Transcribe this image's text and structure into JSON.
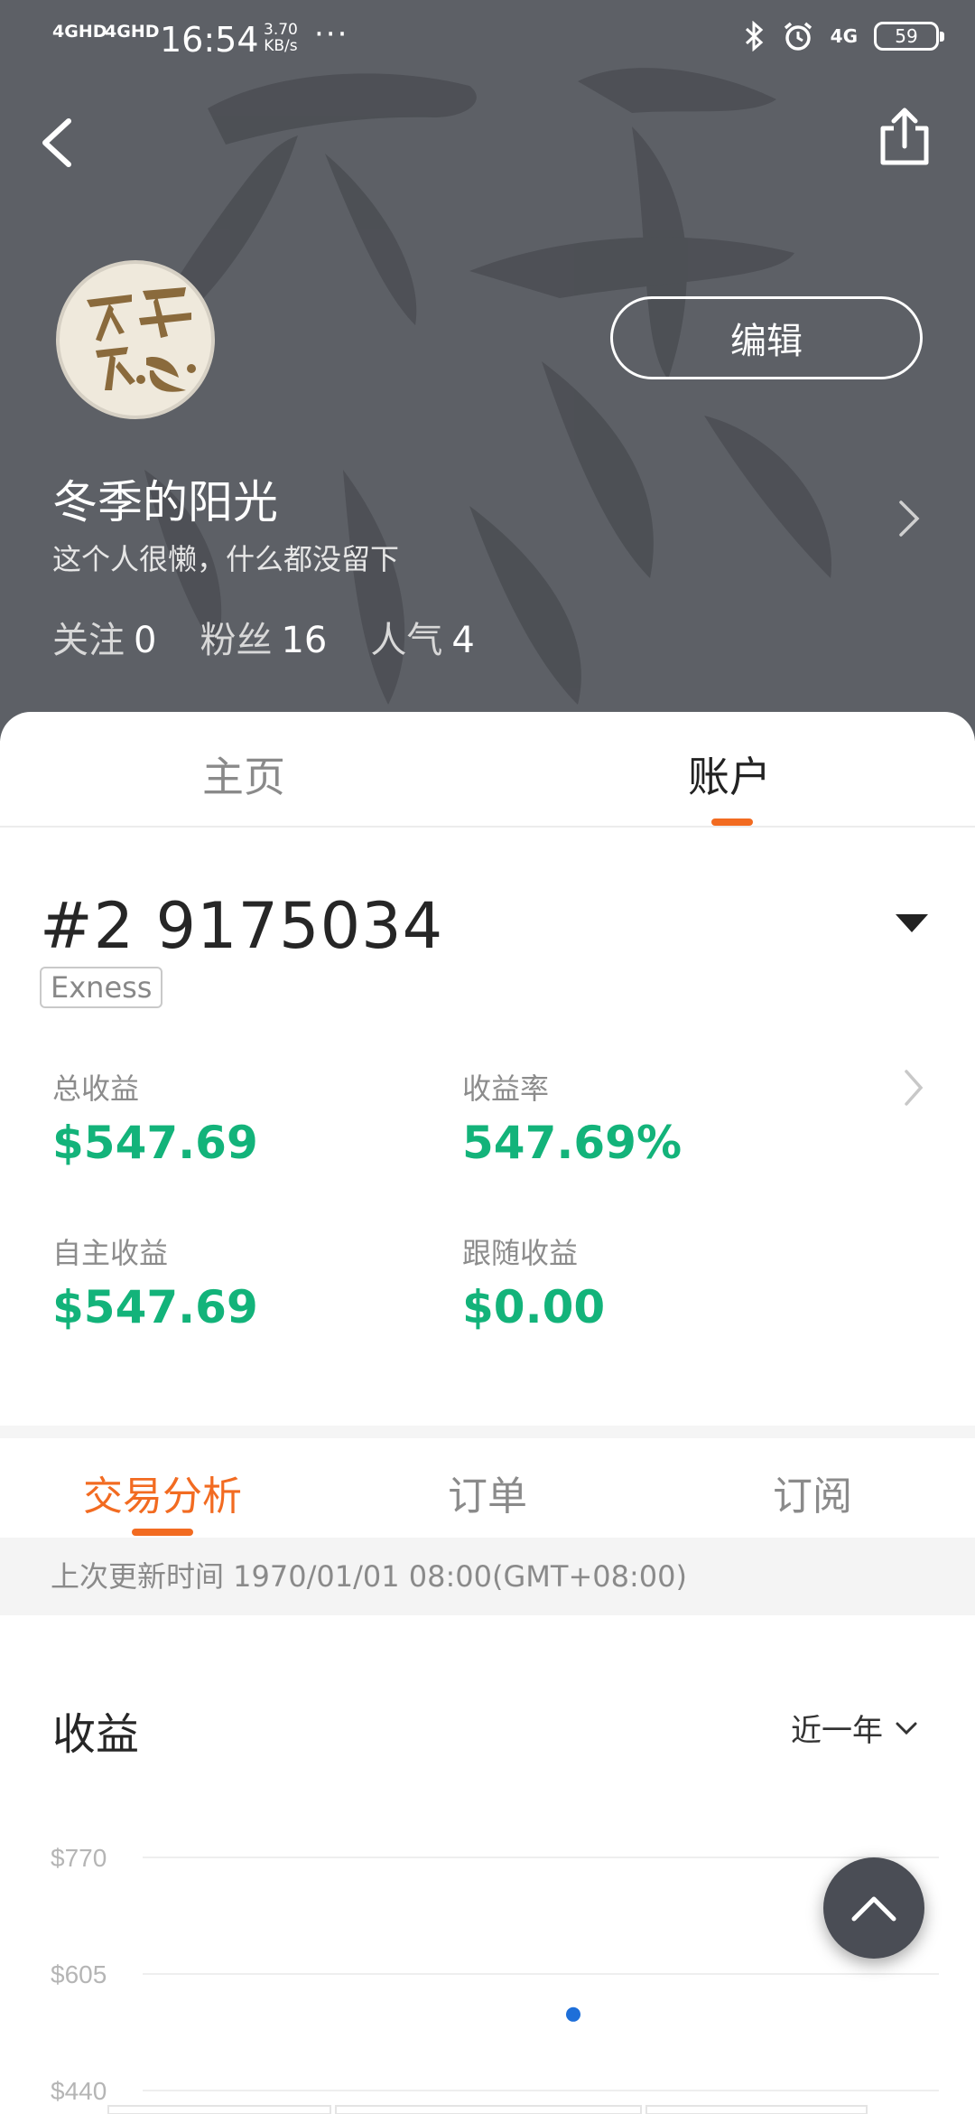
{
  "status_bar": {
    "signal_1": "4GHD",
    "signal_2": "4GHD",
    "time": "16:54",
    "speed_value": "3.70",
    "speed_unit": "KB/s",
    "more": "···",
    "network": "4G",
    "battery": "59"
  },
  "profile": {
    "edit_label": "编辑",
    "username": "冬季的阳光",
    "bio": "这个人很懒，什么都没留下",
    "stats": [
      {
        "label": "关注",
        "value": "0"
      },
      {
        "label": "粉丝",
        "value": "16"
      },
      {
        "label": "人气",
        "value": "4"
      }
    ]
  },
  "tabs": [
    {
      "label": "主页",
      "active": false
    },
    {
      "label": "账户",
      "active": true
    }
  ],
  "account": {
    "number": "#2 9175034",
    "broker": "Exness"
  },
  "metrics": {
    "total_label": "总收益",
    "total_value": "$547.69",
    "rate_label": "收益率",
    "rate_value": "547.69%",
    "self_label": "自主收益",
    "self_value": "$547.69",
    "follow_label": "跟随收益",
    "follow_value": "$0.00"
  },
  "sub_tabs": [
    {
      "label": "交易分析",
      "active": true
    },
    {
      "label": "订单",
      "active": false
    },
    {
      "label": "订阅",
      "active": false
    }
  ],
  "update_text": "上次更新时间 1970/01/01 08:00(GMT+08:00)",
  "income": {
    "title": "收益",
    "period": "近一年"
  },
  "colors": {
    "accent": "#f26b21",
    "profit": "#13b37a",
    "header_bg": "#5d6066",
    "point": "#1e6fd9"
  },
  "chart_data": {
    "type": "scatter",
    "y_ticks": [
      "$770",
      "$605",
      "$440"
    ],
    "ylim": [
      440,
      770
    ],
    "points": [
      {
        "y": 547.69
      }
    ]
  }
}
